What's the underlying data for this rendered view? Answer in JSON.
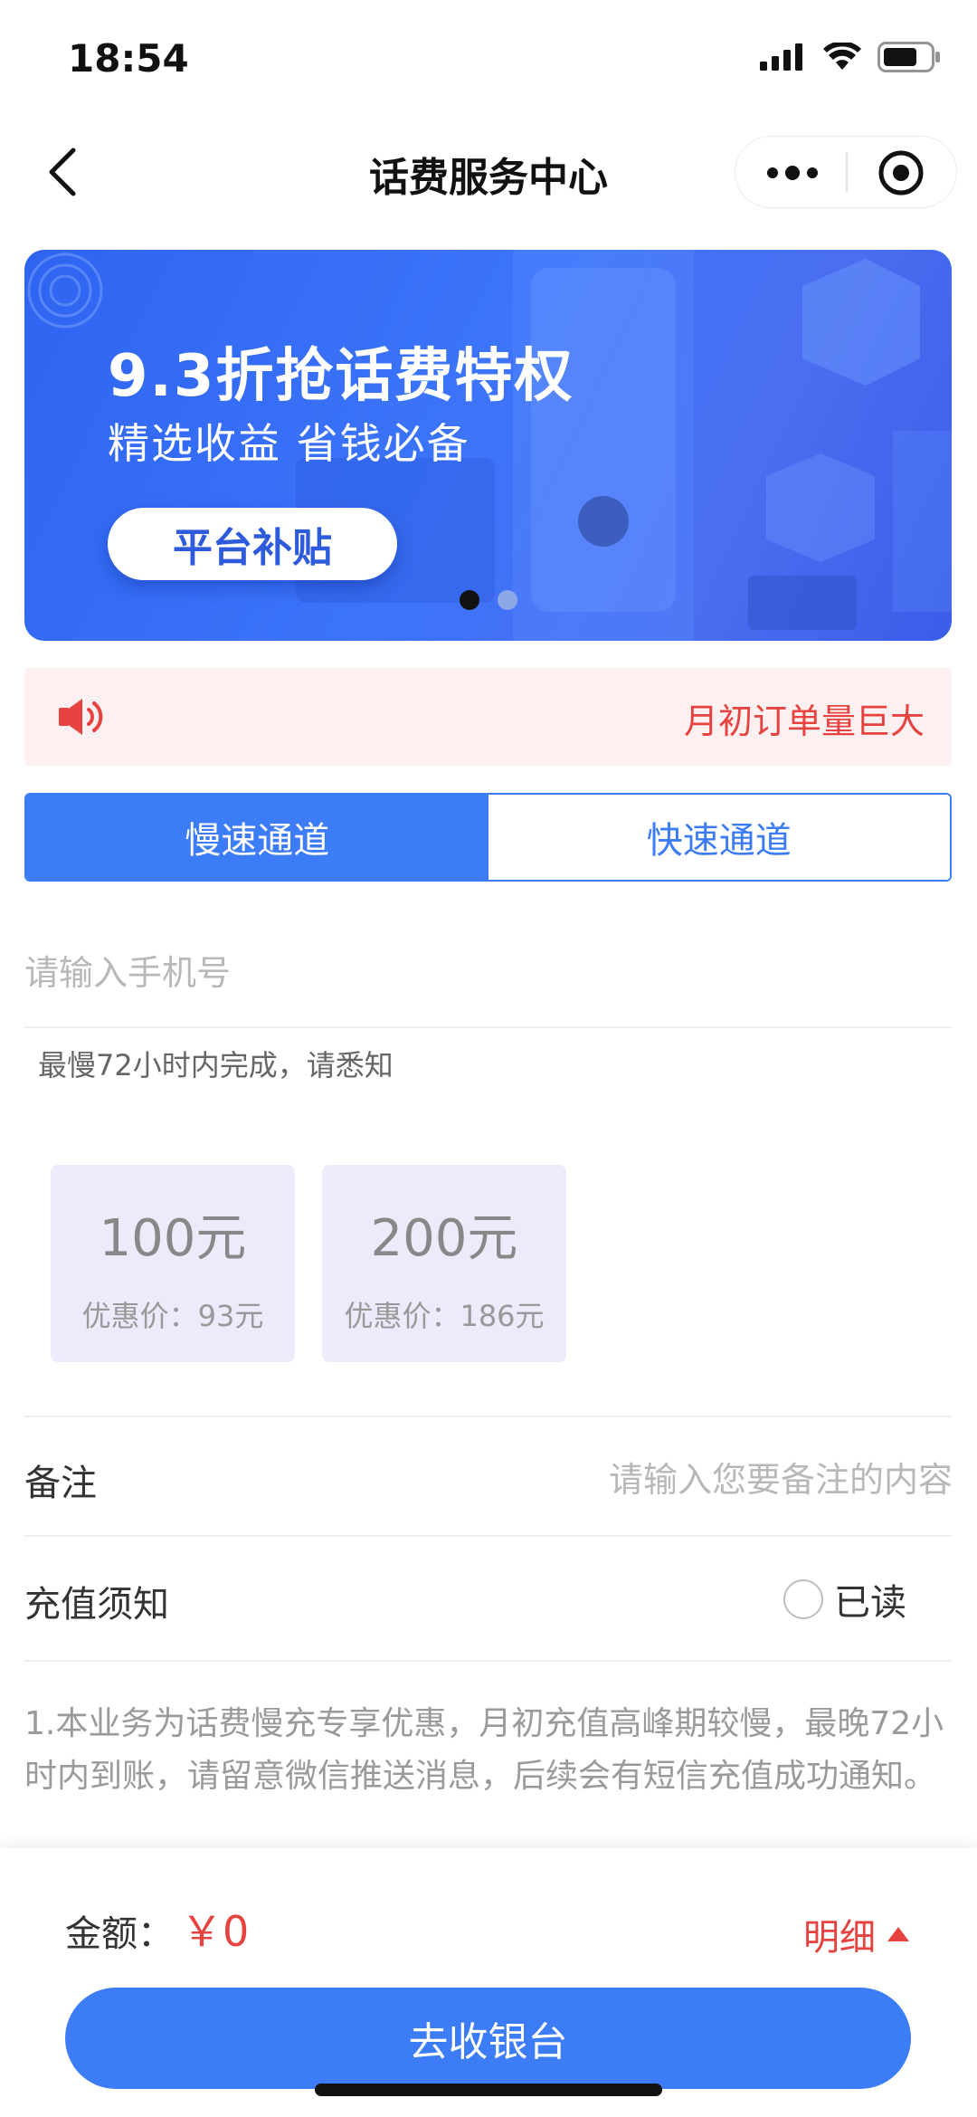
{
  "status_bar": {
    "time": "18:54"
  },
  "nav": {
    "title": "话费服务中心",
    "back_icon": "chevron-left-icon",
    "more_icon": "more-dots-icon",
    "close_icon": "target-close-icon"
  },
  "banner": {
    "title": "9.3折抢话费特权",
    "subtitle": "精选收益 省钱必备",
    "button_label": "平台补贴",
    "dots": {
      "count": 2,
      "active_index": 0
    }
  },
  "notice": {
    "icon": "speaker-icon",
    "text": "月初订单量巨大"
  },
  "tabs": [
    {
      "label": "慢速通道",
      "active": true
    },
    {
      "label": "快速通道",
      "active": false
    }
  ],
  "phone": {
    "placeholder": "请输入手机号",
    "value": ""
  },
  "hint": "最慢72小时内完成，请悉知",
  "options": [
    {
      "amount": "100元",
      "price": "优惠价：93元"
    },
    {
      "amount": "200元",
      "price": "优惠价：186元"
    }
  ],
  "remark": {
    "label": "备注",
    "placeholder": "请输入您要备注的内容"
  },
  "terms": {
    "label": "充值须知",
    "read_label": "已读",
    "checked": false
  },
  "notice_body": "1.本业务为话费慢充专享优惠，月初充值高峰期较慢，最晚72小时内到账，请留意微信推送消息，后续会有短信充值成功通知。",
  "footer": {
    "amount_label": "金额：",
    "amount_value": "￥0",
    "detail_label": "明细",
    "detail_icon": "triangle-up-icon",
    "checkout_label": "去收银台"
  },
  "colors": {
    "primary": "#3d7cf7",
    "accent_red": "#e64340",
    "notice_bg": "#fdf0f0",
    "card_bg": "#ebebfb"
  }
}
